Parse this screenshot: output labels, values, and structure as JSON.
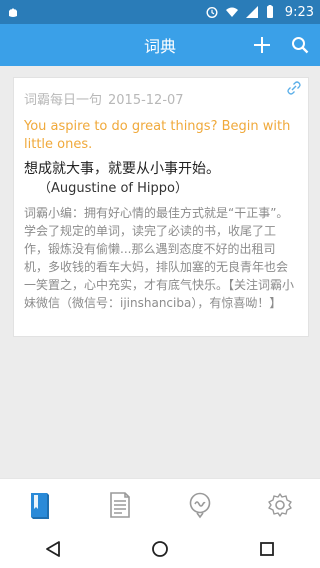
{
  "status_bar": {
    "time": "9:23"
  },
  "app_bar": {
    "title": "词典"
  },
  "card": {
    "source": "词霸每日一句",
    "date": "2015-12-07",
    "quote_en": "You aspire to do great things? Begin with little ones.",
    "quote_cn": "想成就大事，就要从小事开始。",
    "author": "（Augustine of Hippo）",
    "editor_note": "词霸小编：拥有好心情的最佳方式就是“干正事”。学会了规定的单词，读完了必读的书，收尾了工作，锻炼没有偷懒...那么遇到态度不好的出租司机，多收钱的看车大妈，排队加塞的无良青年也会一笑置之，心中充实，才有底气快乐。【关注词霸小妹微信（微信号：ijinshanciba），有惊喜呦！】"
  },
  "colors": {
    "status_bar": "#2a7cb8",
    "app_bar": "#3aa0e8",
    "accent_orange": "#f0a93b",
    "active_tab": "#2a8ad8",
    "inactive_tab": "#9a9a9a"
  },
  "bottom_tabs": [
    {
      "icon": "book-icon",
      "active": true
    },
    {
      "icon": "document-icon",
      "active": false
    },
    {
      "icon": "chat-bubble-icon",
      "active": false
    },
    {
      "icon": "gear-icon",
      "active": false
    }
  ]
}
